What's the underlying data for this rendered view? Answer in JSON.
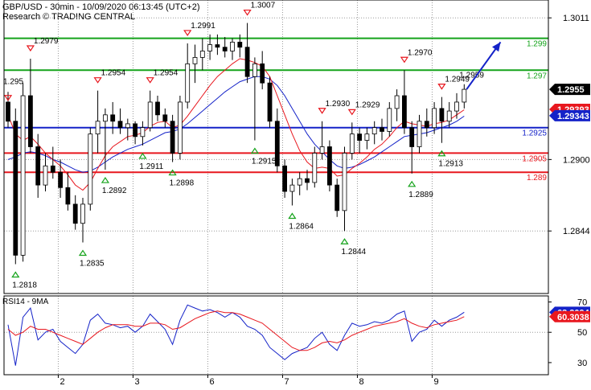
{
  "chart_data": [
    {
      "type": "candlestick",
      "title": "GBP/USD - 30min - 10/09/2020 06:13:45 (UTC+2)",
      "subtitle": "Research © TRADING CENTRAL",
      "ylim": [
        1.2795,
        1.3025
      ],
      "y_ticks": [
        "1.3011",
        "1.2900",
        "1.2844"
      ],
      "x_ticks": [
        "2",
        "3",
        "6",
        "7",
        "8",
        "9"
      ],
      "last_price": {
        "value": 1.2955,
        "label": "1.2955"
      },
      "moving_averages": [
        {
          "name": "ma-red",
          "color": "#e8171e",
          "last_label": "1.29393",
          "last_value": 1.29393
        },
        {
          "name": "ma-blue",
          "color": "#1422c8",
          "last_label": "1.29343",
          "last_value": 1.29343
        }
      ],
      "horizontal_levels": [
        {
          "value": 1.2995,
          "label": "1.299",
          "color": "#15a31b"
        },
        {
          "value": 1.297,
          "label": "1.297",
          "color": "#15a31b"
        },
        {
          "value": 1.2925,
          "label": "1.2925",
          "color": "#1422c8"
        },
        {
          "value": 1.2905,
          "label": "1.2905",
          "color": "#e8171e"
        },
        {
          "value": 1.289,
          "label": "1.289",
          "color": "#e8171e"
        }
      ],
      "annotations": [
        {
          "kind": "high",
          "label": "1.2979",
          "i": 3,
          "value": 1.2979
        },
        {
          "kind": "high",
          "label": "1.2954",
          "i": 12,
          "value": 1.2954
        },
        {
          "kind": "high",
          "label": "1.2954",
          "i": 19,
          "value": 1.2954
        },
        {
          "kind": "high",
          "label": "1.2991",
          "i": 24,
          "value": 1.2991
        },
        {
          "kind": "high",
          "label": "1.3007",
          "i": 32,
          "value": 1.3007
        },
        {
          "kind": "high",
          "label": "1.2930",
          "i": 42,
          "value": 1.293
        },
        {
          "kind": "high",
          "label": "1.2929",
          "i": 46,
          "value": 1.2929
        },
        {
          "kind": "high",
          "label": "1.2970",
          "i": 53,
          "value": 1.297
        },
        {
          "kind": "high",
          "label": "1.2949",
          "i": 58,
          "value": 1.2949
        },
        {
          "kind": "low",
          "label": "1.2818",
          "i": 1,
          "value": 1.2818
        },
        {
          "kind": "low",
          "label": "1.2892",
          "i": 13,
          "value": 1.2892
        },
        {
          "kind": "low",
          "label": "1.2911",
          "i": 18,
          "value": 1.2911
        },
        {
          "kind": "low",
          "label": "1.2898",
          "i": 22,
          "value": 1.2898
        },
        {
          "kind": "low",
          "label": "1.2835",
          "i": 10,
          "value": 1.2835
        },
        {
          "kind": "low",
          "label": "1.2915",
          "i": 33,
          "value": 1.2915
        },
        {
          "kind": "low",
          "label": "1.2864",
          "i": 38,
          "value": 1.2864
        },
        {
          "kind": "low",
          "label": "1.2844",
          "i": 45,
          "value": 1.2844
        },
        {
          "kind": "low",
          "label": "1.2889",
          "i": 54,
          "value": 1.2889
        },
        {
          "kind": "low",
          "label": "1.2913",
          "i": 58,
          "value": 1.2913
        }
      ],
      "edge_labels": [
        {
          "label": "1.295",
          "i": 0,
          "value": 1.2954
        },
        {
          "label": "1.2959",
          "i": 61,
          "value": 1.2959
        }
      ],
      "forecast_arrow": {
        "from_i": 61,
        "from": 1.2955,
        "to_i": 65,
        "to": 1.2992,
        "color": "#1422c8"
      },
      "candles": [
        {
          "i": 0,
          "o": 1.2945,
          "h": 1.2953,
          "l": 1.2925,
          "c": 1.293
        },
        {
          "i": 1,
          "o": 1.293,
          "h": 1.294,
          "l": 1.2818,
          "c": 1.2825
        },
        {
          "i": 2,
          "o": 1.2825,
          "h": 1.296,
          "l": 1.282,
          "c": 1.295
        },
        {
          "i": 3,
          "o": 1.295,
          "h": 1.2979,
          "l": 1.2905,
          "c": 1.291
        },
        {
          "i": 4,
          "o": 1.291,
          "h": 1.292,
          "l": 1.287,
          "c": 1.288
        },
        {
          "i": 5,
          "o": 1.288,
          "h": 1.2905,
          "l": 1.2875,
          "c": 1.2895
        },
        {
          "i": 6,
          "o": 1.2895,
          "h": 1.291,
          "l": 1.2885,
          "c": 1.289
        },
        {
          "i": 7,
          "o": 1.289,
          "h": 1.29,
          "l": 1.287,
          "c": 1.2878
        },
        {
          "i": 8,
          "o": 1.2878,
          "h": 1.289,
          "l": 1.286,
          "c": 1.2865
        },
        {
          "i": 9,
          "o": 1.2865,
          "h": 1.2872,
          "l": 1.2845,
          "c": 1.285
        },
        {
          "i": 10,
          "o": 1.285,
          "h": 1.287,
          "l": 1.2835,
          "c": 1.2865
        },
        {
          "i": 11,
          "o": 1.2865,
          "h": 1.2925,
          "l": 1.286,
          "c": 1.292
        },
        {
          "i": 12,
          "o": 1.292,
          "h": 1.2954,
          "l": 1.2905,
          "c": 1.293
        },
        {
          "i": 13,
          "o": 1.293,
          "h": 1.294,
          "l": 1.2892,
          "c": 1.2935
        },
        {
          "i": 14,
          "o": 1.2935,
          "h": 1.2945,
          "l": 1.292,
          "c": 1.293
        },
        {
          "i": 15,
          "o": 1.293,
          "h": 1.294,
          "l": 1.292,
          "c": 1.2925
        },
        {
          "i": 16,
          "o": 1.2925,
          "h": 1.2932,
          "l": 1.2915,
          "c": 1.2928
        },
        {
          "i": 17,
          "o": 1.2928,
          "h": 1.293,
          "l": 1.2912,
          "c": 1.2918
        },
        {
          "i": 18,
          "o": 1.2918,
          "h": 1.293,
          "l": 1.2911,
          "c": 1.2925
        },
        {
          "i": 19,
          "o": 1.2925,
          "h": 1.2954,
          "l": 1.2922,
          "c": 1.2945
        },
        {
          "i": 20,
          "o": 1.2945,
          "h": 1.295,
          "l": 1.293,
          "c": 1.2935
        },
        {
          "i": 21,
          "o": 1.2935,
          "h": 1.294,
          "l": 1.2925,
          "c": 1.293
        },
        {
          "i": 22,
          "o": 1.293,
          "h": 1.2935,
          "l": 1.2898,
          "c": 1.2905
        },
        {
          "i": 23,
          "o": 1.2905,
          "h": 1.295,
          "l": 1.29,
          "c": 1.2945
        },
        {
          "i": 24,
          "o": 1.2945,
          "h": 1.2991,
          "l": 1.294,
          "c": 1.2975
        },
        {
          "i": 25,
          "o": 1.2975,
          "h": 1.299,
          "l": 1.296,
          "c": 1.298
        },
        {
          "i": 26,
          "o": 1.298,
          "h": 1.2995,
          "l": 1.297,
          "c": 1.2985
        },
        {
          "i": 27,
          "o": 1.2985,
          "h": 1.2998,
          "l": 1.2978,
          "c": 1.299
        },
        {
          "i": 28,
          "o": 1.299,
          "h": 1.2998,
          "l": 1.2982,
          "c": 1.2988
        },
        {
          "i": 29,
          "o": 1.2988,
          "h": 1.2996,
          "l": 1.298,
          "c": 1.2985
        },
        {
          "i": 30,
          "o": 1.2985,
          "h": 1.2995,
          "l": 1.2978,
          "c": 1.2992
        },
        {
          "i": 31,
          "o": 1.2992,
          "h": 1.2998,
          "l": 1.298,
          "c": 1.2988
        },
        {
          "i": 32,
          "o": 1.2988,
          "h": 1.3007,
          "l": 1.296,
          "c": 1.2965
        },
        {
          "i": 33,
          "o": 1.2965,
          "h": 1.298,
          "l": 1.2915,
          "c": 1.2975
        },
        {
          "i": 34,
          "o": 1.2975,
          "h": 1.2985,
          "l": 1.2955,
          "c": 1.296
        },
        {
          "i": 35,
          "o": 1.296,
          "h": 1.2965,
          "l": 1.2925,
          "c": 1.293
        },
        {
          "i": 36,
          "o": 1.293,
          "h": 1.294,
          "l": 1.289,
          "c": 1.2895
        },
        {
          "i": 37,
          "o": 1.2895,
          "h": 1.29,
          "l": 1.287,
          "c": 1.2875
        },
        {
          "i": 38,
          "o": 1.2875,
          "h": 1.2885,
          "l": 1.2864,
          "c": 1.288
        },
        {
          "i": 39,
          "o": 1.288,
          "h": 1.289,
          "l": 1.2872,
          "c": 1.2885
        },
        {
          "i": 40,
          "o": 1.2885,
          "h": 1.2892,
          "l": 1.2876,
          "c": 1.2882
        },
        {
          "i": 41,
          "o": 1.2882,
          "h": 1.291,
          "l": 1.2878,
          "c": 1.2905
        },
        {
          "i": 42,
          "o": 1.2905,
          "h": 1.293,
          "l": 1.29,
          "c": 1.291
        },
        {
          "i": 43,
          "o": 1.291,
          "h": 1.2915,
          "l": 1.2875,
          "c": 1.288
        },
        {
          "i": 44,
          "o": 1.288,
          "h": 1.2885,
          "l": 1.2855,
          "c": 1.286
        },
        {
          "i": 45,
          "o": 1.286,
          "h": 1.291,
          "l": 1.2844,
          "c": 1.2905
        },
        {
          "i": 46,
          "o": 1.2905,
          "h": 1.2929,
          "l": 1.29,
          "c": 1.292
        },
        {
          "i": 47,
          "o": 1.292,
          "h": 1.2925,
          "l": 1.2905,
          "c": 1.2915
        },
        {
          "i": 48,
          "o": 1.2915,
          "h": 1.2925,
          "l": 1.2908,
          "c": 1.292
        },
        {
          "i": 49,
          "o": 1.292,
          "h": 1.293,
          "l": 1.2912,
          "c": 1.2925
        },
        {
          "i": 50,
          "o": 1.2925,
          "h": 1.2932,
          "l": 1.2915,
          "c": 1.2922
        },
        {
          "i": 51,
          "o": 1.2922,
          "h": 1.2945,
          "l": 1.2918,
          "c": 1.294
        },
        {
          "i": 52,
          "o": 1.294,
          "h": 1.2955,
          "l": 1.293,
          "c": 1.295
        },
        {
          "i": 53,
          "o": 1.295,
          "h": 1.297,
          "l": 1.292,
          "c": 1.2925
        },
        {
          "i": 54,
          "o": 1.2925,
          "h": 1.293,
          "l": 1.2889,
          "c": 1.291
        },
        {
          "i": 55,
          "o": 1.291,
          "h": 1.2935,
          "l": 1.2905,
          "c": 1.293
        },
        {
          "i": 56,
          "o": 1.293,
          "h": 1.294,
          "l": 1.2918,
          "c": 1.2925
        },
        {
          "i": 57,
          "o": 1.2925,
          "h": 1.2945,
          "l": 1.292,
          "c": 1.294
        },
        {
          "i": 58,
          "o": 1.294,
          "h": 1.2949,
          "l": 1.2913,
          "c": 1.293
        },
        {
          "i": 59,
          "o": 1.293,
          "h": 1.2945,
          "l": 1.2925,
          "c": 1.2938
        },
        {
          "i": 60,
          "o": 1.2938,
          "h": 1.2952,
          "l": 1.2932,
          "c": 1.2945
        },
        {
          "i": 61,
          "o": 1.2945,
          "h": 1.2959,
          "l": 1.294,
          "c": 1.2955
        }
      ],
      "ma_red": [
        1.2935,
        1.292,
        1.2915,
        1.2918,
        1.2912,
        1.2905,
        1.29,
        1.2895,
        1.2888,
        1.288,
        1.2876,
        1.2882,
        1.2893,
        1.2903,
        1.291,
        1.2914,
        1.2918,
        1.2919,
        1.2921,
        1.2926,
        1.2929,
        1.293,
        1.2925,
        1.2927,
        1.2934,
        1.2942,
        1.295,
        1.2958,
        1.2965,
        1.297,
        1.2975,
        1.2979,
        1.2978,
        1.2976,
        1.2973,
        1.2965,
        1.295,
        1.2935,
        1.292,
        1.2907,
        1.2898,
        1.2893,
        1.2894,
        1.2893,
        1.2887,
        1.2888,
        1.2893,
        1.2897,
        1.2902,
        1.2908,
        1.2912,
        1.2918,
        1.2925,
        1.293,
        1.2928,
        1.2927,
        1.2926,
        1.2928,
        1.2929,
        1.2931,
        1.2935,
        1.2939
      ],
      "ma_blue": [
        1.29,
        1.2902,
        1.2905,
        1.2906,
        1.2905,
        1.2903,
        1.29,
        1.2898,
        1.2895,
        1.2892,
        1.289,
        1.2891,
        1.2894,
        1.2898,
        1.2902,
        1.2905,
        1.2908,
        1.291,
        1.2912,
        1.2915,
        1.2918,
        1.2921,
        1.2922,
        1.2924,
        1.2928,
        1.2933,
        1.2938,
        1.2943,
        1.2948,
        1.2953,
        1.2957,
        1.2961,
        1.2963,
        1.2965,
        1.2965,
        1.2963,
        1.2958,
        1.295,
        1.294,
        1.293,
        1.292,
        1.2912,
        1.2906,
        1.29,
        1.2895,
        1.2893,
        1.2894,
        1.2896,
        1.2899,
        1.2902,
        1.2906,
        1.291,
        1.2914,
        1.2918,
        1.2919,
        1.292,
        1.2921,
        1.2923,
        1.2925,
        1.2927,
        1.293,
        1.2934
      ]
    },
    {
      "type": "line",
      "title": "RSI14 - 9MA",
      "ylim": [
        22,
        74
      ],
      "y_ticks": [
        "70",
        "50",
        "30"
      ],
      "reference_lines": [
        50
      ],
      "last_labels": [
        {
          "name": "rsi",
          "label": "63.2094",
          "value": 63.2094,
          "color": "#1422c8"
        },
        {
          "name": "ma9",
          "label": "60.3038",
          "value": 60.3038,
          "color": "#e8171e"
        }
      ],
      "series": [
        {
          "name": "rsi",
          "color": "#1422c8",
          "values": [
            55,
            28,
            60,
            66,
            45,
            50,
            52,
            44,
            40,
            36,
            42,
            58,
            62,
            56,
            55,
            53,
            54,
            50,
            54,
            62,
            57,
            52,
            42,
            58,
            68,
            66,
            64,
            65,
            63,
            60,
            63,
            60,
            54,
            52,
            48,
            40,
            36,
            32,
            36,
            38,
            40,
            46,
            50,
            42,
            38,
            48,
            56,
            54,
            55,
            57,
            56,
            58,
            62,
            64,
            44,
            50,
            52,
            58,
            54,
            58,
            60,
            63.2094
          ]
        },
        {
          "name": "ma9",
          "color": "#e8171e",
          "values": [
            52,
            48,
            50,
            54,
            52,
            52,
            50,
            48,
            46,
            44,
            42,
            46,
            50,
            53,
            55,
            55,
            55,
            54,
            54,
            56,
            56,
            55,
            52,
            53,
            56,
            59,
            61,
            63,
            64,
            63,
            63,
            62,
            60,
            58,
            56,
            52,
            48,
            44,
            40,
            38,
            38,
            40,
            43,
            44,
            43,
            45,
            48,
            50,
            52,
            54,
            55,
            56,
            57,
            59,
            56,
            54,
            53,
            55,
            56,
            57,
            58,
            60.3038
          ]
        }
      ]
    }
  ]
}
